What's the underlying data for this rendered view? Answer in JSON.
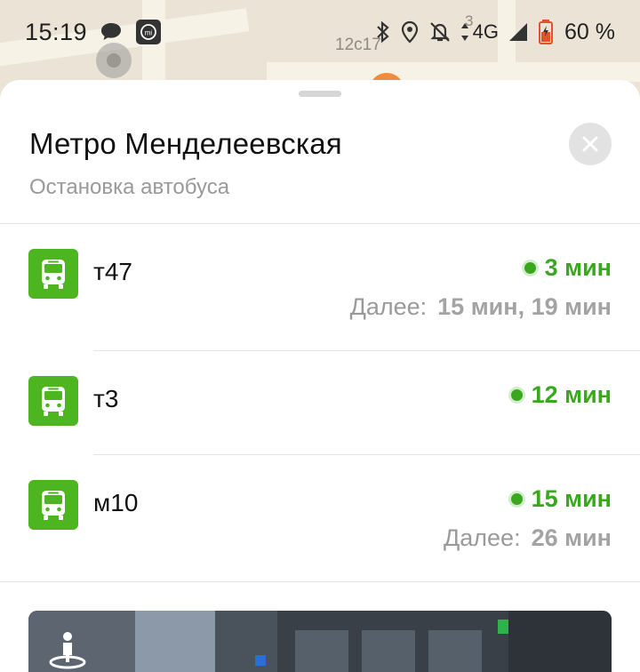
{
  "status_bar": {
    "time": "15:19",
    "network": "4G",
    "battery": "60 %",
    "icons": [
      "chat-bubble-icon",
      "mi-app-icon",
      "bluetooth-icon",
      "location-icon",
      "notifications-off-icon",
      "data-arrows-icon",
      "signal-icon",
      "battery-icon"
    ]
  },
  "map": {
    "labels": [
      "12с17",
      "3"
    ]
  },
  "stop": {
    "title": "Метро Менделеевская",
    "subtitle": "Остановка автобуса"
  },
  "routes": [
    {
      "number": "т47",
      "arrival": "3 мин",
      "next_label": "Далее:",
      "next_values": "15 мин, 19 мин"
    },
    {
      "number": "т3",
      "arrival": "12 мин",
      "next_label": "",
      "next_values": ""
    },
    {
      "number": "м10",
      "arrival": "15 мин",
      "next_label": "Далее:",
      "next_values": "26 мин"
    }
  ],
  "colors": {
    "accent_green": "#4cb51f",
    "arrival_green": "#3aa81e",
    "muted_text": "#9a9a9a"
  }
}
